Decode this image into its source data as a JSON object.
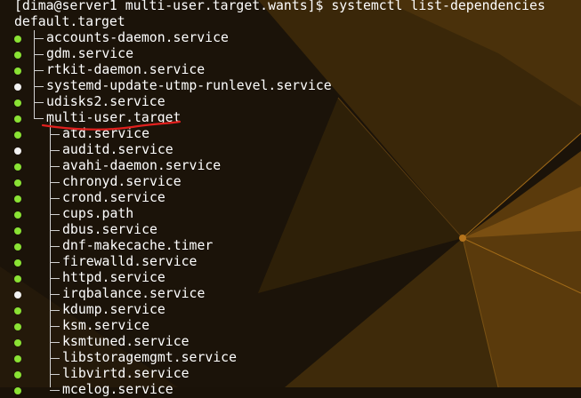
{
  "terminal": {
    "prompt": "[dima@server1 multi-user.target.wants]$ systemctl list-dependencies",
    "root_unit": "default.target",
    "level1": [
      {
        "name": "accounts-daemon.service",
        "state": "active"
      },
      {
        "name": "gdm.service",
        "state": "active"
      },
      {
        "name": "rtkit-daemon.service",
        "state": "active"
      },
      {
        "name": "systemd-update-utmp-runlevel.service",
        "state": "inactive"
      },
      {
        "name": "udisks2.service",
        "state": "active"
      },
      {
        "name": "multi-user.target",
        "state": "active",
        "annotated": true
      }
    ],
    "level2": [
      {
        "name": "atd.service",
        "state": "active"
      },
      {
        "name": "auditd.service",
        "state": "inactive"
      },
      {
        "name": "avahi-daemon.service",
        "state": "active"
      },
      {
        "name": "chronyd.service",
        "state": "active"
      },
      {
        "name": "crond.service",
        "state": "active"
      },
      {
        "name": "cups.path",
        "state": "active"
      },
      {
        "name": "dbus.service",
        "state": "active"
      },
      {
        "name": "dnf-makecache.timer",
        "state": "active"
      },
      {
        "name": "firewalld.service",
        "state": "active"
      },
      {
        "name": "httpd.service",
        "state": "active"
      },
      {
        "name": "irqbalance.service",
        "state": "inactive"
      },
      {
        "name": "kdump.service",
        "state": "active"
      },
      {
        "name": "ksm.service",
        "state": "active"
      },
      {
        "name": "ksmtuned.service",
        "state": "active"
      },
      {
        "name": "libstoragemgmt.service",
        "state": "active"
      },
      {
        "name": "libvirtd.service",
        "state": "active"
      },
      {
        "name": "mcelog.service",
        "state": "active"
      }
    ]
  },
  "colors": {
    "active_dot": "#8ae234",
    "inactive_dot": "#f2f2f2",
    "text": "#ffffff",
    "annotation": "#e0201e",
    "background_dark": "#1a1208",
    "background_accent": "#b5741c"
  }
}
